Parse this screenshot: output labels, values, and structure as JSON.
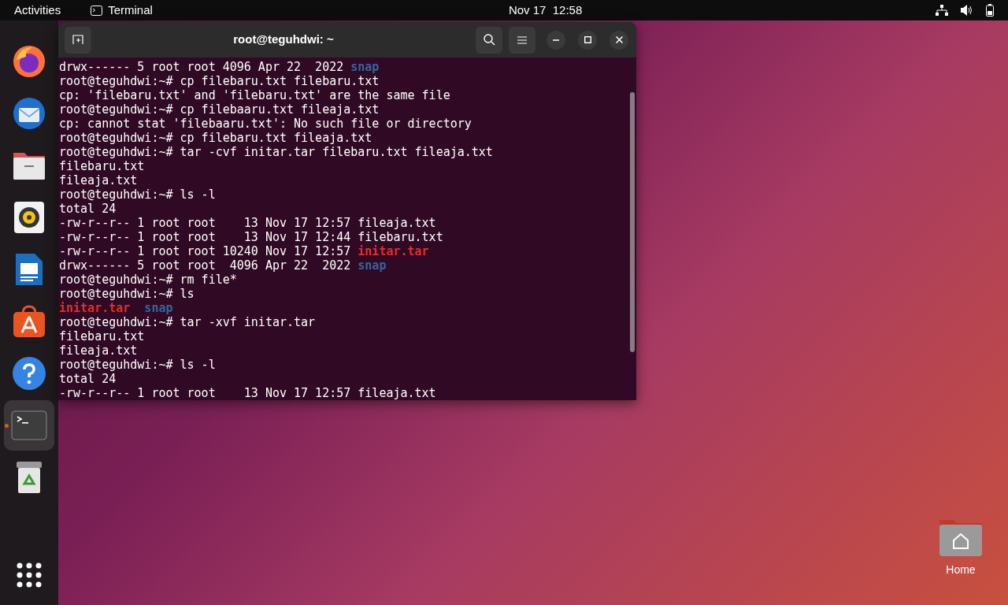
{
  "top_bar": {
    "activities": "Activities",
    "app_name": "Terminal",
    "clock": "Nov 17  12:58"
  },
  "dock": {
    "items": [
      {
        "kind": "firefox",
        "running": false,
        "selected": false
      },
      {
        "kind": "mail",
        "running": false,
        "selected": false
      },
      {
        "kind": "files",
        "running": false,
        "selected": false
      },
      {
        "kind": "music",
        "running": false,
        "selected": false
      },
      {
        "kind": "writer",
        "running": false,
        "selected": false
      },
      {
        "kind": "store",
        "running": false,
        "selected": false
      },
      {
        "kind": "help",
        "running": false,
        "selected": false
      },
      {
        "kind": "terminal",
        "running": true,
        "selected": true
      },
      {
        "kind": "trash",
        "running": false,
        "selected": false
      }
    ]
  },
  "window": {
    "title": "root@teguhdwi: ~",
    "lines": [
      [
        {
          "text": "drwx------ 5 root root 4096 Apr 22  2022 ",
          "kind": "plain"
        },
        {
          "text": "snap",
          "kind": "dir"
        }
      ],
      [
        {
          "text": "root@teguhdwi:~# cp filebaru.txt filebaru.txt",
          "kind": "plain"
        }
      ],
      [
        {
          "text": "cp: 'filebaru.txt' and 'filebaru.txt' are the same file",
          "kind": "plain"
        }
      ],
      [
        {
          "text": "root@teguhdwi:~# cp filebaaru.txt fileaja.txt",
          "kind": "plain"
        }
      ],
      [
        {
          "text": "cp: cannot stat 'filebaaru.txt': No such file or directory",
          "kind": "plain"
        }
      ],
      [
        {
          "text": "root@teguhdwi:~# cp filebaru.txt fileaja.txt",
          "kind": "plain"
        }
      ],
      [
        {
          "text": "root@teguhdwi:~# tar -cvf initar.tar filebaru.txt fileaja.txt",
          "kind": "plain"
        }
      ],
      [
        {
          "text": "filebaru.txt",
          "kind": "plain"
        }
      ],
      [
        {
          "text": "fileaja.txt",
          "kind": "plain"
        }
      ],
      [
        {
          "text": "root@teguhdwi:~# ls -l",
          "kind": "plain"
        }
      ],
      [
        {
          "text": "total 24",
          "kind": "plain"
        }
      ],
      [
        {
          "text": "-rw-r--r-- 1 root root    13 Nov 17 12:57 fileaja.txt",
          "kind": "plain"
        }
      ],
      [
        {
          "text": "-rw-r--r-- 1 root root    13 Nov 17 12:44 filebaru.txt",
          "kind": "plain"
        }
      ],
      [
        {
          "text": "-rw-r--r-- 1 root root 10240 Nov 17 12:57 ",
          "kind": "plain"
        },
        {
          "text": "initar.tar",
          "kind": "archive"
        }
      ],
      [
        {
          "text": "drwx------ 5 root root  4096 Apr 22  2022 ",
          "kind": "plain"
        },
        {
          "text": "snap",
          "kind": "dir"
        }
      ],
      [
        {
          "text": "root@teguhdwi:~# rm file*",
          "kind": "plain"
        }
      ],
      [
        {
          "text": "root@teguhdwi:~# ls",
          "kind": "plain"
        }
      ],
      [
        {
          "text": "initar.tar",
          "kind": "archive"
        },
        {
          "text": "snap",
          "kind": "dir",
          "spaced": true
        }
      ],
      [
        {
          "text": "root@teguhdwi:~# tar -xvf initar.tar",
          "kind": "plain"
        }
      ],
      [
        {
          "text": "filebaru.txt",
          "kind": "plain"
        }
      ],
      [
        {
          "text": "fileaja.txt",
          "kind": "plain"
        }
      ],
      [
        {
          "text": "root@teguhdwi:~# ls -l",
          "kind": "plain"
        }
      ],
      [
        {
          "text": "total 24",
          "kind": "plain"
        }
      ],
      [
        {
          "text": "-rw-r--r-- 1 root root    13 Nov 17 12:57 fileaja.txt",
          "kind": "plain"
        }
      ]
    ]
  },
  "desktop": {
    "home_label": "Home"
  }
}
